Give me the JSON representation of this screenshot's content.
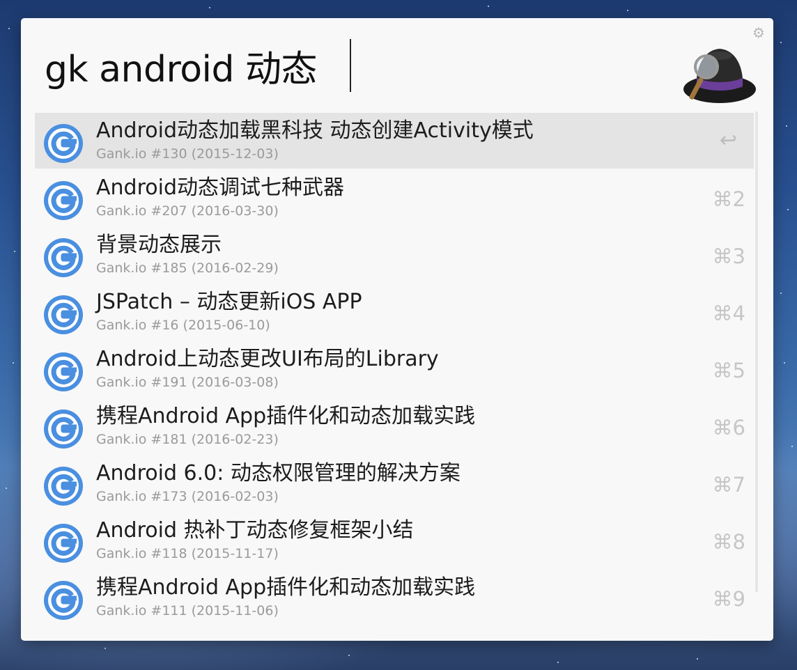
{
  "search": {
    "query": "gk android 动态"
  },
  "icons": {
    "settings": "gear-icon",
    "app_logo": "alfred-hat-icon",
    "result": "gank-g-icon"
  },
  "colors": {
    "panel_bg": "#f8f8f8",
    "selected_row": "#e4e4e4",
    "g_icon_blue": "#4a8fe0",
    "subtitle": "#9a9a9a"
  },
  "results": [
    {
      "title": "Android动态加载黑科技 动态创建Activity模式",
      "subtitle": "Gank.io #130 (2015-12-03)",
      "shortcut": "↩"
    },
    {
      "title": "Android动态调试七种武器",
      "subtitle": "Gank.io #207 (2016-03-30)",
      "shortcut": "⌘2"
    },
    {
      "title": "背景动态展示",
      "subtitle": "Gank.io #185 (2016-02-29)",
      "shortcut": "⌘3"
    },
    {
      "title": "JSPatch – 动态更新iOS APP",
      "subtitle": "Gank.io #16 (2015-06-10)",
      "shortcut": "⌘4"
    },
    {
      "title": "Android上动态更改UI布局的Library",
      "subtitle": "Gank.io #191 (2016-03-08)",
      "shortcut": "⌘5"
    },
    {
      "title": "携程Android App插件化和动态加载实践",
      "subtitle": "Gank.io #181 (2016-02-23)",
      "shortcut": "⌘6"
    },
    {
      "title": "Android 6.0: 动态权限管理的解决方案",
      "subtitle": "Gank.io #173 (2016-02-03)",
      "shortcut": "⌘7"
    },
    {
      "title": " Android 热补丁动态修复框架小结",
      "subtitle": "Gank.io #118 (2015-11-17)",
      "shortcut": "⌘8"
    },
    {
      "title": "携程Android App插件化和动态加载实践",
      "subtitle": "Gank.io #111 (2015-11-06)",
      "shortcut": "⌘9"
    }
  ]
}
